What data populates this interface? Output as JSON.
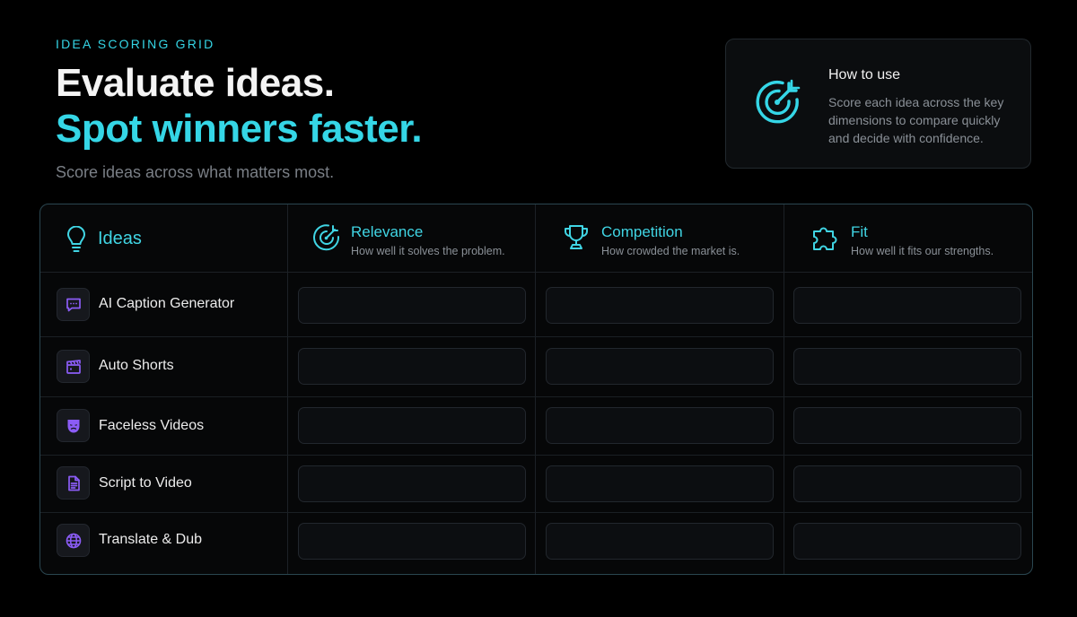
{
  "header": {
    "eyebrow": "IDEA SCORING GRID",
    "title_line1": "Evaluate ideas.",
    "title_line2": "Spot winners faster.",
    "subtitle": "Score ideas across what matters most."
  },
  "how_to": {
    "title": "How to use",
    "text": "Score each idea across the key dimensions to compare quickly and decide with confidence."
  },
  "grid": {
    "ideas_header": "Ideas",
    "columns": [
      {
        "title": "Relevance",
        "description": "How well it solves the problem."
      },
      {
        "title": "Competition",
        "description": "How crowded the market is."
      },
      {
        "title": "Fit",
        "description": "How well it fits our strengths."
      }
    ],
    "rows": [
      {
        "label": "AI Caption Generator",
        "icon": "chat-bubble-icon"
      },
      {
        "label": "Auto Shorts",
        "icon": "clapperboard-icon"
      },
      {
        "label": "Faceless Videos",
        "icon": "mask-icon"
      },
      {
        "label": "Script to Video",
        "icon": "document-icon"
      },
      {
        "label": "Translate & Dub",
        "icon": "globe-icon"
      }
    ]
  },
  "colors": {
    "accent": "#35d6e6",
    "icon_purple": "#8b5cf6",
    "background": "#000000"
  }
}
